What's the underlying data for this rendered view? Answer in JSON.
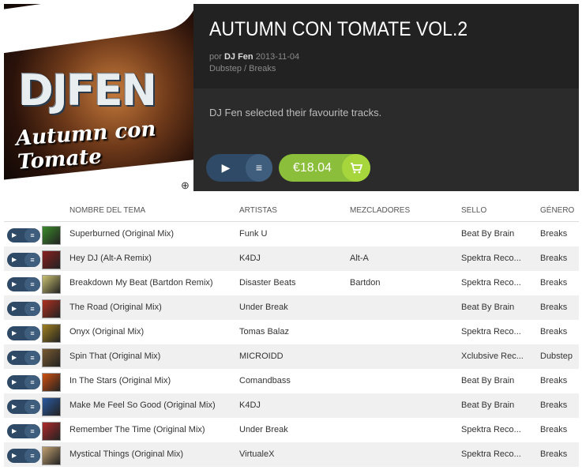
{
  "release": {
    "title": "AUTUMN CON TOMATE VOL.2",
    "by_label": "por",
    "artist": "DJ Fen",
    "date": "2013-11-04",
    "genres": "Dubstep / Breaks",
    "description": "DJ Fen selected their favourite tracks.",
    "price": "€18.04",
    "cover_logo": "DJFEN",
    "cover_script": "Autumn con Tomate"
  },
  "icons": {
    "play": "▶",
    "queue": "≡",
    "cart": "🛒",
    "zoom": "⊕"
  },
  "table": {
    "headers": [
      "NOMBRE DEL TEMA",
      "ARTISTAS",
      "MEZCLADORES",
      "SELLO",
      "GÉNERO"
    ],
    "rows": [
      {
        "title": "Superburned (Original Mix)",
        "artist": "Funk U",
        "remixer": "",
        "label": "Beat By Brain",
        "genre": "Breaks",
        "art_color": "#3a8a2a"
      },
      {
        "title": "Hey DJ (Alt-A Remix)",
        "artist": "K4DJ",
        "remixer": "Alt-A",
        "label": "Spektra Reco...",
        "genre": "Breaks",
        "art_color": "#8a2020"
      },
      {
        "title": "Breakdown My Beat (Bartdon Remix)",
        "artist": "Disaster Beats",
        "remixer": "Bartdon",
        "label": "Spektra Reco...",
        "genre": "Breaks",
        "art_color": "#c9c070"
      },
      {
        "title": "The Road (Original Mix)",
        "artist": "Under Break",
        "remixer": "",
        "label": "Beat By Brain",
        "genre": "Breaks",
        "art_color": "#b03020"
      },
      {
        "title": "Onyx (Original Mix)",
        "artist": "Tomas Balaz",
        "remixer": "",
        "label": "Spektra Reco...",
        "genre": "Breaks",
        "art_color": "#a08020"
      },
      {
        "title": "Spin That (Original Mix)",
        "artist": "MICROIDD",
        "remixer": "",
        "label": "Xclubsive Rec...",
        "genre": "Dubstep",
        "art_color": "#7a5a30"
      },
      {
        "title": "In The Stars (Original Mix)",
        "artist": "Comandbass",
        "remixer": "",
        "label": "Beat By Brain",
        "genre": "Breaks",
        "art_color": "#d05010"
      },
      {
        "title": "Make Me Feel So Good (Original Mix)",
        "artist": "K4DJ",
        "remixer": "",
        "label": "Beat By Brain",
        "genre": "Breaks",
        "art_color": "#2a5aa0"
      },
      {
        "title": "Remember The Time (Original Mix)",
        "artist": "Under Break",
        "remixer": "",
        "label": "Spektra Reco...",
        "genre": "Breaks",
        "art_color": "#b02a2a"
      },
      {
        "title": "Mystical Things (Original Mix)",
        "artist": "VirtualeX",
        "remixer": "",
        "label": "Spektra Reco...",
        "genre": "Breaks",
        "art_color": "#c0a070"
      }
    ]
  }
}
